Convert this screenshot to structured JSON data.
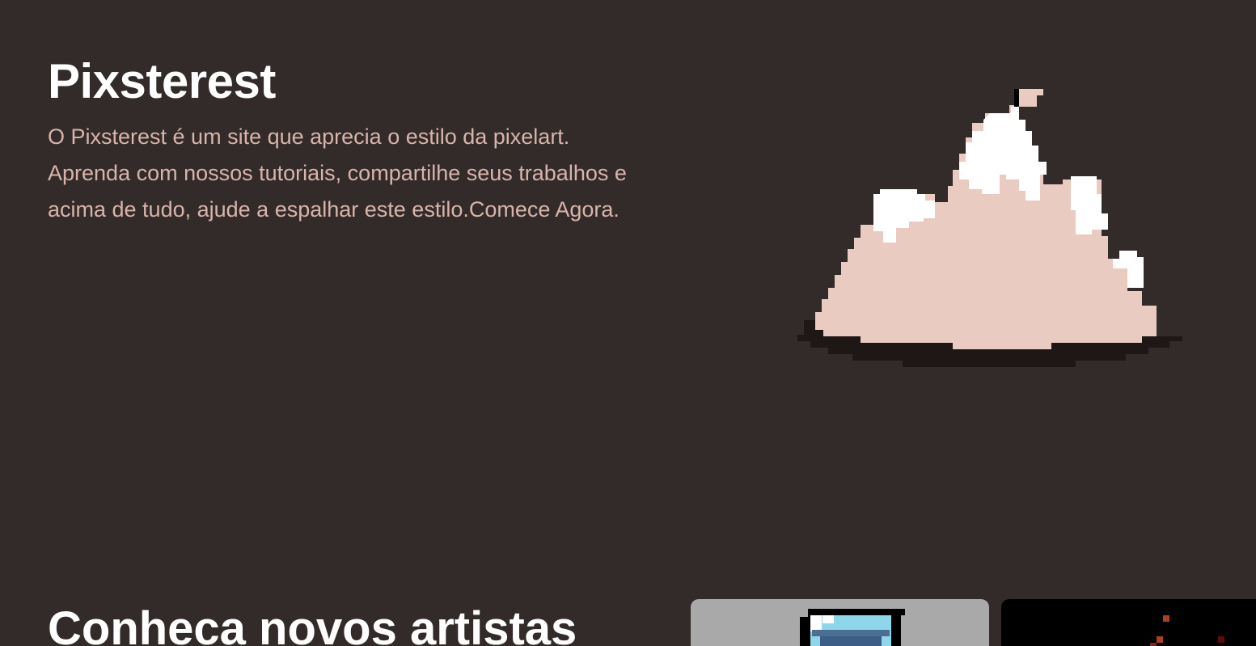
{
  "hero": {
    "title": "Pixsterest",
    "description": "O Pixsterest é um site que aprecia o estilo da pixelart. Aprenda com nossos tutoriais, compartilhe seus trabalhos e acima de tudo, ajude a espalhar este estilo.Comece Agora."
  },
  "artists_section": {
    "title": "Conheca novos artistas"
  },
  "colors": {
    "background": "#332b2a",
    "text_primary": "#ffffff",
    "text_secondary": "#d8b4ab",
    "mountain_body": "#eacbc2",
    "mountain_snow": "#ffffff",
    "shadow": "#1f1716"
  }
}
